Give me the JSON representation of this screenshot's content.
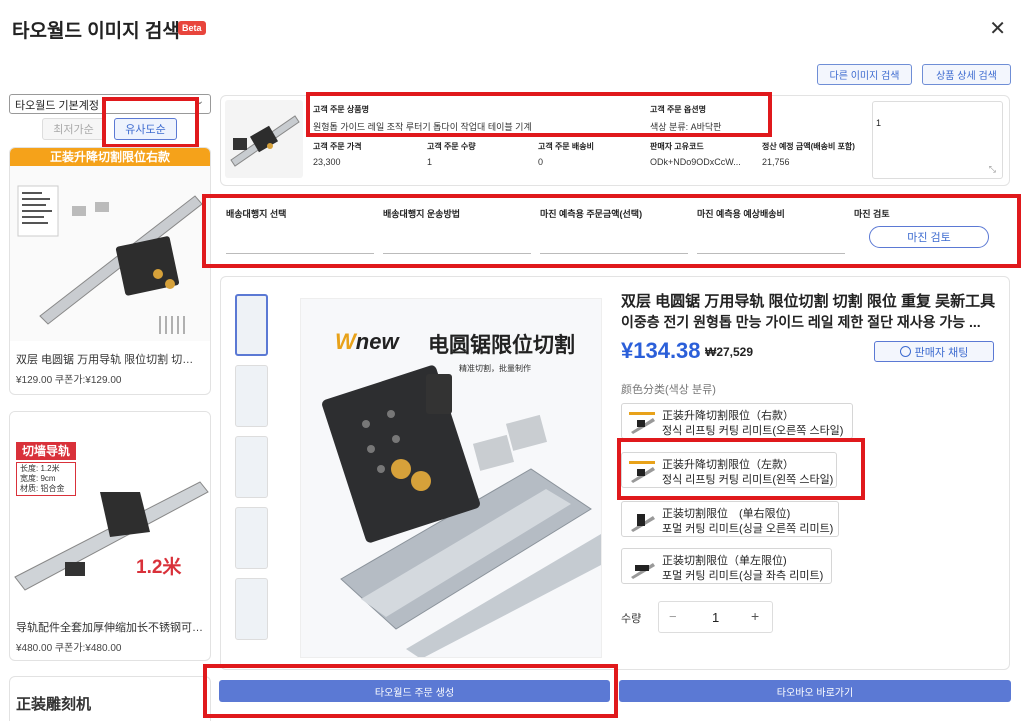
{
  "header": {
    "title": "타오월드 이미지 검색",
    "beta": "Beta",
    "close": "✕"
  },
  "top_buttons": {
    "other_image_search": "다른 이미지 검색",
    "detail_search": "상품 상세 검색"
  },
  "sidebar": {
    "select_value": "타오월드 기본계정",
    "sort_cheapest": "최저가순",
    "sort_similar": "유사도순",
    "cards": [
      {
        "banner": "正装升降切割限位右款",
        "title": "双层 电圆锯 万用导轨 限位切割 切割 限...",
        "price": "¥129.00 쿠폰가:¥129.00"
      },
      {
        "banner": "切墙导轨",
        "spec1": "长度: 1.2米",
        "spec2": "宽度: 9cm",
        "spec3": "材质: 铝合金",
        "tag": "1.2米",
        "title": "导轨配件全套加厚伸缩加长不锈钢可调...",
        "price": "¥480.00 쿠폰가:¥480.00"
      },
      {
        "banner": "正装雕刻机"
      }
    ]
  },
  "order": {
    "product_name_label": "고객 주문 상품명",
    "product_name": "원형톱 가이드 레일 조작 루터기 톱다이 작업대 테이블 기계",
    "option_label": "고객 주문 옵션명",
    "option_value": "색상 분류: A바닥판",
    "price_label": "고객 주문 가격",
    "price": "23,300",
    "qty_label": "고객 주문 수량",
    "qty": "1",
    "shipping_label": "고객 주문 배송비",
    "shipping": "0",
    "seller_code_label": "판매자 고유코드",
    "seller_code": "ODk+NDo9ODxCcW...",
    "settle_label": "정산 예정 금액(배송비 포함)",
    "settle": "21,756",
    "memo_value": "1"
  },
  "margin": {
    "agent_label": "배송대행지 선택",
    "method_label": "배송대행지 운송방법",
    "est_price_label": "마진 예측용 주문금액(선택)",
    "est_shipping_label": "마진 예측용 예상배송비",
    "review_label": "마진 검토",
    "review_button": "마진 검토"
  },
  "product": {
    "title_cn": "双层 电圆锯 万用导轨 限位切割 切割 限位 重复 吴新工具",
    "title_kr": "이중층 전기 원형톱 만능 가이드 레일 제한 절단 재사용 가능 ...",
    "price_cny": "¥134.38",
    "price_krw": "₩27,529",
    "seller_chat": "판매자 채팅",
    "image_brand": "new",
    "image_title": "电圆锯限位切割",
    "image_sub": "精准切割，批量制作",
    "color_label": "颜色分类(색상 분류)",
    "options": [
      {
        "cn": "正装升降切割限位（右款）",
        "kr": "정식 리프팅 커팅 리미트(오른쪽 스타일)"
      },
      {
        "cn": "正装升降切割限位（左款）",
        "kr": "정식 리프팅 커팅 리미트(왼쪽 스타일)"
      },
      {
        "cn": "正装切割限位　(单右限位)",
        "kr": "포멀 커팅 리미트(싱글 오른쪽 리미트)"
      },
      {
        "cn": "正装切割限位（单左限位)",
        "kr": "포멀 커팅 리미트(싱글 좌측 리미트)"
      }
    ],
    "qty_label": "수량",
    "qty_minus": "−",
    "qty_value": "1",
    "qty_plus": "+"
  },
  "footer": {
    "create_order": "타오월드 주문 생성",
    "goto_taobao": "타오바오 바로가기"
  },
  "colors": {
    "accent_blue": "#5b79d4",
    "highlight_red": "#e0191c",
    "price_blue": "#2b5fd9",
    "banner_orange": "#f5a21a",
    "banner_red": "#d9313a"
  }
}
